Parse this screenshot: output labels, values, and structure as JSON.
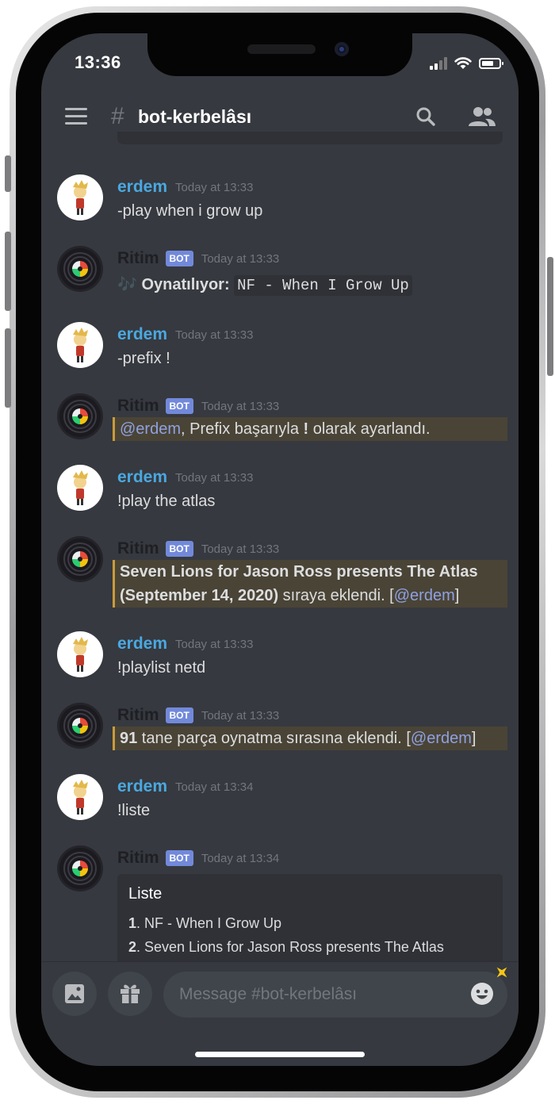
{
  "status_bar": {
    "time": "13:36"
  },
  "header": {
    "channel": "bot-kerbelâsı"
  },
  "messages": [
    {
      "author": "erdem",
      "timestamp": "Today at 13:33",
      "text": "-play when i grow up"
    },
    {
      "author": "Ritim",
      "bot_tag": "BOT",
      "timestamp": "Today at 13:33",
      "note_icon": "🎶",
      "label": "Oynatılıyor:",
      "code": "NF - When I Grow Up"
    },
    {
      "author": "erdem",
      "timestamp": "Today at 13:33",
      "text": "-prefix !"
    },
    {
      "author": "Ritim",
      "bot_tag": "BOT",
      "timestamp": "Today at 13:33",
      "mention": "@erdem",
      "text_a": ", Prefix başarıyla ",
      "bold": "!",
      "text_b": " olarak ayarlandı."
    },
    {
      "author": "erdem",
      "timestamp": "Today at 13:33",
      "text": "!play the atlas"
    },
    {
      "author": "Ritim",
      "bot_tag": "BOT",
      "timestamp": "Today at 13:33",
      "bold_line1": "Seven Lions for Jason Ross presents The Atlas",
      "bold_line2": "(September 14, 2020)",
      "text": " sıraya eklendi. [",
      "mention": "@erdem",
      "close": "]"
    },
    {
      "author": "erdem",
      "timestamp": "Today at 13:33",
      "text": "!playlist netd"
    },
    {
      "author": "Ritim",
      "bot_tag": "BOT",
      "timestamp": "Today at 13:33",
      "bold": "91",
      "text": " tane parça oynatma sırasına eklendi. [",
      "mention": "@erdem",
      "close": "]"
    },
    {
      "author": "erdem",
      "timestamp": "Today at 13:34",
      "text": "!liste"
    },
    {
      "author": "Ritim",
      "bot_tag": "BOT",
      "timestamp": "Today at 13:34"
    }
  ],
  "embed": {
    "title": "Liste",
    "items": [
      {
        "num": "1",
        "text": ". NF - When I Grow Up"
      },
      {
        "num": "2",
        "text": ". Seven Lions for Jason Ross presents The Atlas"
      }
    ]
  },
  "composer": {
    "placeholder": "Message #bot-kerbelâsı"
  },
  "colors": {
    "background": "#36393f",
    "username": "#4aa8e0",
    "bot_tag": "#7289da",
    "mention_highlight": "#4a4437",
    "mention_border": "#c99b3a"
  }
}
